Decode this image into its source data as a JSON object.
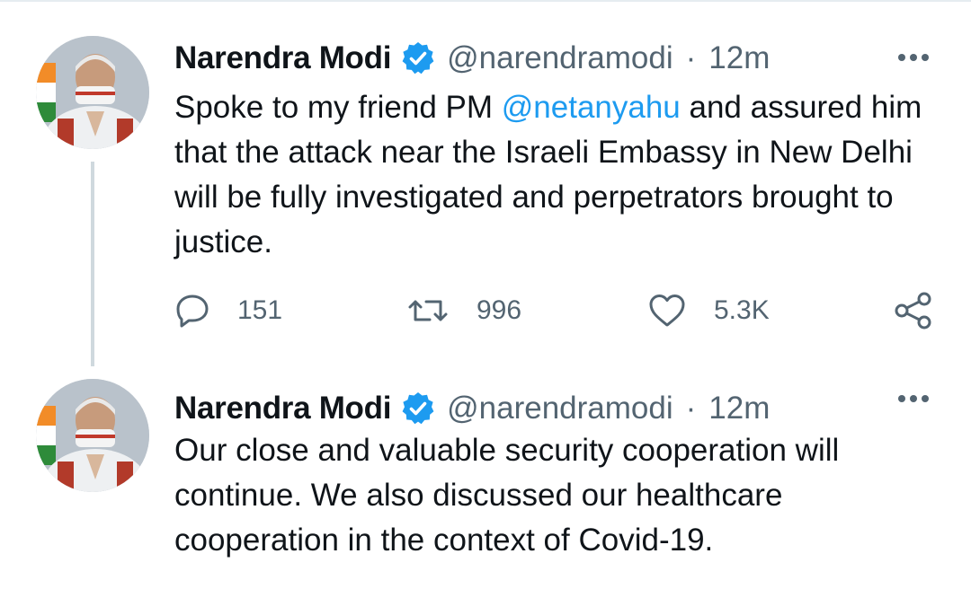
{
  "tweets": [
    {
      "author_name": "Narendra Modi",
      "handle": "@narendramodi",
      "separator": "·",
      "time": "12m",
      "text_before": "Spoke to my friend PM ",
      "mention": "@netanyahu",
      "text_after": " and assured him that the attack near the Israeli Embassy in New Delhi will be fully investigated and perpetrators brought to justice.",
      "stats": {
        "replies": "151",
        "retweets": "996",
        "likes": "5.3K"
      }
    },
    {
      "author_name": "Narendra Modi",
      "handle": "@narendramodi",
      "separator": "·",
      "time": "12m",
      "text": "Our close and valuable security cooperation will continue. We also discussed our healthcare cooperation in the context of Covid-19."
    }
  ],
  "icons": {
    "verified": "verified-badge-icon",
    "more": "more-options-icon",
    "reply": "reply-icon",
    "retweet": "retweet-icon",
    "like": "heart-icon",
    "share": "share-icon"
  },
  "colors": {
    "accent": "#1d9bf0",
    "text": "#0f1419",
    "secondary": "#536471",
    "thread_line": "#cfd9de"
  }
}
